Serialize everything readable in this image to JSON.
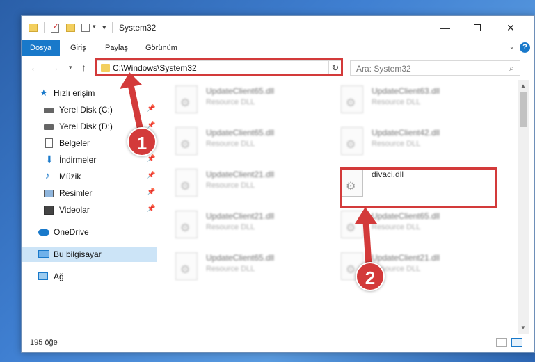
{
  "window": {
    "title": "System32"
  },
  "ribbon": {
    "tabs": [
      "Dosya",
      "Giriş",
      "Paylaş",
      "Görünüm"
    ],
    "help": "?"
  },
  "nav": {
    "address": "C:\\Windows\\System32",
    "search_placeholder": "Ara: System32"
  },
  "sidebar": {
    "items": [
      {
        "label": "Hızlı erişim",
        "icon": "star-icon",
        "pinned": false
      },
      {
        "label": "Yerel Disk (C:)",
        "icon": "drive-icon",
        "pinned": true
      },
      {
        "label": "Yerel Disk (D:)",
        "icon": "drive-icon",
        "pinned": true
      },
      {
        "label": "Belgeler",
        "icon": "document-icon",
        "pinned": true
      },
      {
        "label": "İndirmeler",
        "icon": "download-icon",
        "pinned": true
      },
      {
        "label": "Müzik",
        "icon": "music-icon",
        "pinned": true
      },
      {
        "label": "Resimler",
        "icon": "pictures-icon",
        "pinned": true
      },
      {
        "label": "Videolar",
        "icon": "video-icon",
        "pinned": true
      },
      {
        "label": "OneDrive",
        "icon": "cloud-icon",
        "pinned": false
      },
      {
        "label": "Bu bilgisayar",
        "icon": "computer-icon",
        "pinned": false
      },
      {
        "label": "Ağ",
        "icon": "network-icon",
        "pinned": false
      }
    ]
  },
  "files": [
    {
      "name": "UpdateClient65.dll",
      "desc": "Resource DLL"
    },
    {
      "name": "UpdateClient63.dll",
      "desc": "Resource DLL"
    },
    {
      "name": "UpdateClient65.dll",
      "desc": "Resource DLL"
    },
    {
      "name": "UpdateClient42.dll",
      "desc": "Resource DLL"
    },
    {
      "name": "UpdateClient21.dll",
      "desc": "Resource DLL"
    },
    {
      "name": "divaci.dll",
      "desc": ""
    },
    {
      "name": "UpdateClient21.dll",
      "desc": "Resource DLL"
    },
    {
      "name": "UpdateClient65.dll",
      "desc": "Resource DLL"
    },
    {
      "name": "UpdateClient65.dll",
      "desc": "Resource DLL"
    },
    {
      "name": "UpdateClient21.dll",
      "desc": "Resource DLL"
    }
  ],
  "status": {
    "count": "195 öğe"
  },
  "callouts": {
    "one": "1",
    "two": "2"
  },
  "colors": {
    "accent": "#1979ca",
    "highlight": "#d33a3a",
    "selected": "#cce4f7"
  }
}
